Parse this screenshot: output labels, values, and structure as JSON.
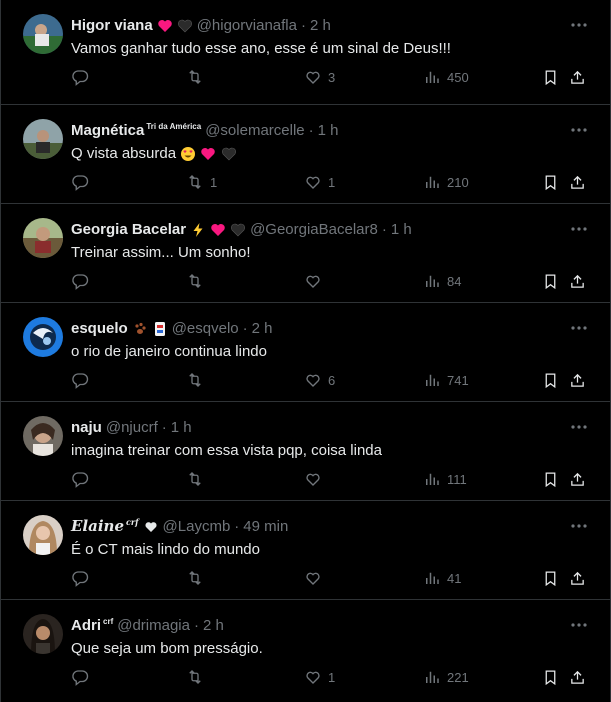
{
  "colors": {
    "background": "#000000",
    "text": "#e7e9ea",
    "muted": "#71767b",
    "divider": "#2f3336",
    "heart_red": "#f91880",
    "heart_black": "#2b2b2b"
  },
  "action_icons": [
    "reply-icon",
    "retweet-icon",
    "like-icon",
    "views-icon",
    "bookmark-icon",
    "share-icon"
  ],
  "tweets": [
    {
      "name": "Higor viana",
      "name_emoji": [
        "red-heart",
        "black-heart"
      ],
      "handle": "@higorvianafla",
      "sep": "·",
      "time": "2 h",
      "text": "Vamos ganhar tudo esse ano, esse é um sinal de Deus!!!",
      "text_emoji": [],
      "replies": "",
      "retweets": "",
      "likes": "3",
      "views": "450"
    },
    {
      "name": "Magnética",
      "name_sup": "Tri da América",
      "handle": "@solemarcelle",
      "sep": "·",
      "time": "1 h",
      "text": "Q vista absurda",
      "text_emoji": [
        "heart-eyes-face",
        "red-heart",
        "black-heart"
      ],
      "replies": "",
      "retweets": "1",
      "likes": "1",
      "views": "210"
    },
    {
      "name": "Georgia Bacelar",
      "name_emoji": [
        "high-voltage",
        "red-heart",
        "black-heart"
      ],
      "handle": "@GeorgiaBacelar8",
      "sep": "·",
      "time": "1 h",
      "text": "Treinar assim... Um sonho!",
      "text_emoji": [],
      "replies": "",
      "retweets": "",
      "likes": "",
      "views": "84"
    },
    {
      "name": "esquelo",
      "name_emoji": [
        "paw-prints",
        "mahjong-tile"
      ],
      "handle": "@esqvelo",
      "sep": "·",
      "time": "2 h",
      "text": "o rio de janeiro continua lindo",
      "text_emoji": [],
      "replies": "",
      "retweets": "",
      "likes": "6",
      "views": "741"
    },
    {
      "name": "naju",
      "handle": "@njucrf",
      "sep": "·",
      "time": "1 h",
      "text": "imagina treinar com essa vista pqp, coisa linda",
      "text_emoji": [],
      "replies": "",
      "retweets": "",
      "likes": "",
      "views": "111"
    },
    {
      "name": "Elaine",
      "name_sup": "crf",
      "name_emoji": [
        "black-heart-small"
      ],
      "handle": "@Laycmb",
      "sep": "·",
      "time": "49 min",
      "text": "É o CT mais lindo do mundo",
      "text_emoji": [],
      "replies": "",
      "retweets": "",
      "likes": "",
      "views": "41"
    },
    {
      "name": "Adri",
      "name_sup": "crf",
      "handle": "@drimagia",
      "sep": "·",
      "time": "2 h",
      "text": "Que seja um bom presságio.",
      "text_emoji": [],
      "replies": "",
      "retweets": "",
      "likes": "1",
      "views": "221"
    }
  ]
}
